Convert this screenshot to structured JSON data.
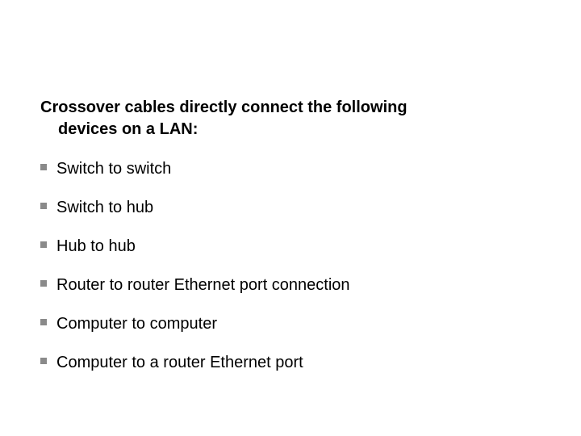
{
  "heading": {
    "line1": "Crossover cables directly connect the following",
    "line2": "devices on a LAN:"
  },
  "items": [
    "Switch to switch",
    "Switch to hub",
    "Hub to hub",
    "Router to router Ethernet port connection",
    "Computer to computer",
    "Computer to a router Ethernet port"
  ]
}
